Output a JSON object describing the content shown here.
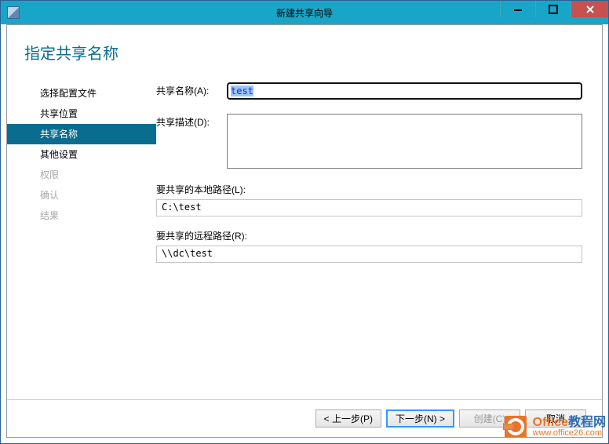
{
  "window": {
    "title": "新建共享向导"
  },
  "heading": "指定共享名称",
  "sidebar": {
    "items": [
      {
        "label": "选择配置文件",
        "state": "enabled"
      },
      {
        "label": "共享位置",
        "state": "enabled"
      },
      {
        "label": "共享名称",
        "state": "active"
      },
      {
        "label": "其他设置",
        "state": "enabled"
      },
      {
        "label": "权限",
        "state": "disabled"
      },
      {
        "label": "确认",
        "state": "disabled"
      },
      {
        "label": "结果",
        "state": "disabled"
      }
    ]
  },
  "form": {
    "share_name_label": "共享名称(A):",
    "share_name_value": "test",
    "share_desc_label": "共享描述(D):",
    "share_desc_value": "",
    "local_path_label": "要共享的本地路径(L):",
    "local_path_value": "C:\\test",
    "remote_path_label": "要共享的远程路径(R):",
    "remote_path_value": "\\\\dc\\test"
  },
  "footer": {
    "prev": "< 上一步(P)",
    "next": "下一步(N) >",
    "create": "创建(C)",
    "cancel": "取消"
  },
  "watermark": {
    "line1a": "Office",
    "line1b": "教程网",
    "line2": "www.office26.com"
  }
}
